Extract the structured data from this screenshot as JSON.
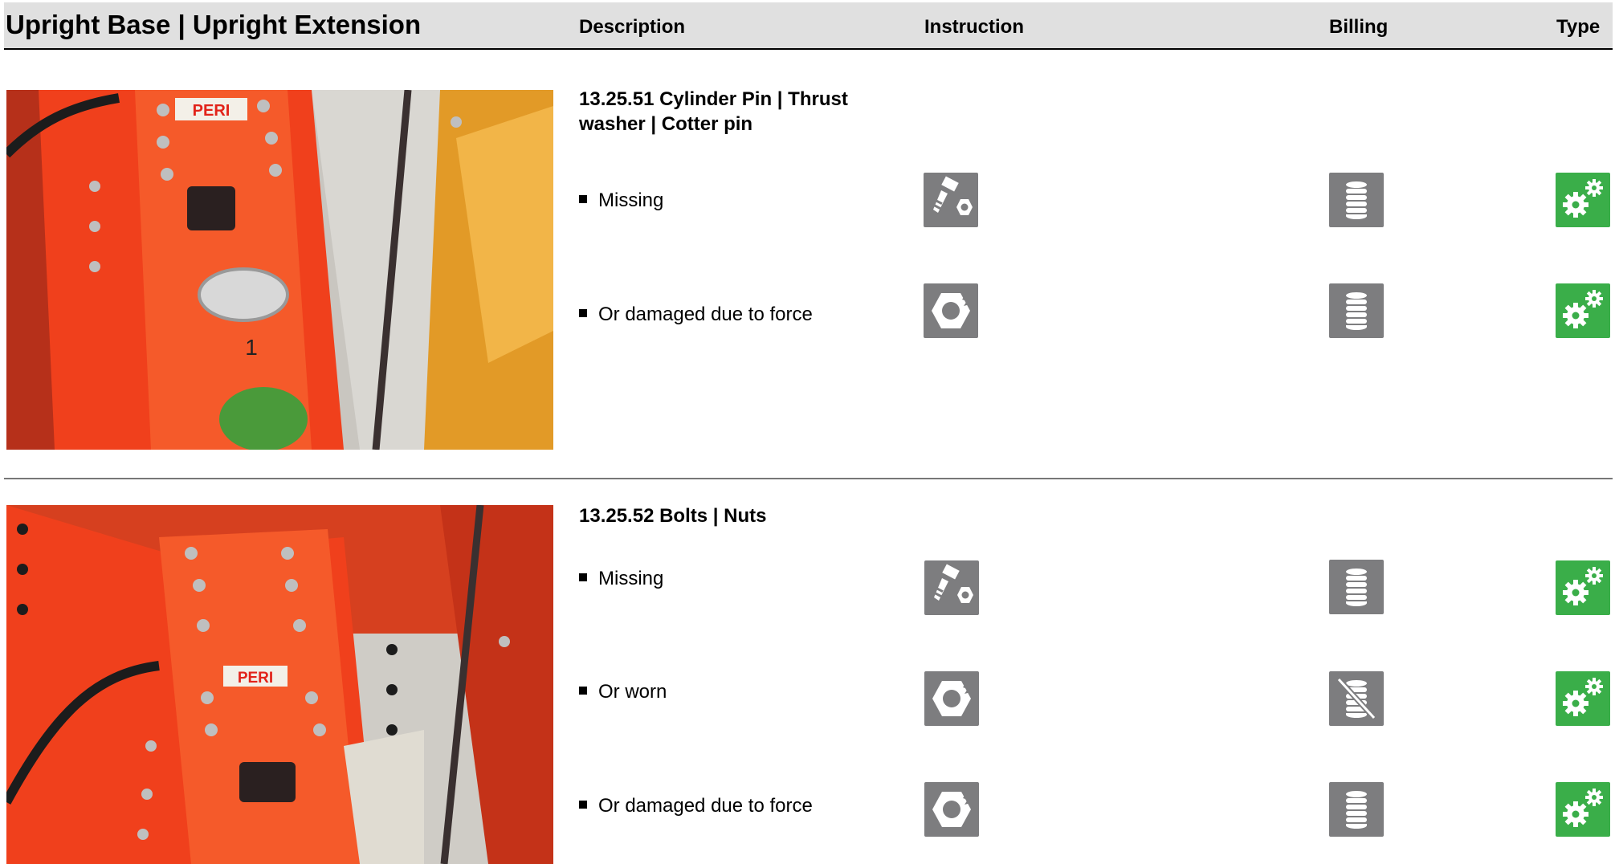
{
  "header": {
    "title": "Upright Base | Upright Extension",
    "col_description": "Description",
    "col_instruction": "Instruction",
    "col_billing": "Billing",
    "col_type": "Type"
  },
  "groups": [
    {
      "title": "13.25.51 Cylinder Pin | Thrust washer | Cotter pin",
      "photo_label": "PERI",
      "photo_number": "1",
      "items": [
        {
          "text": "Missing",
          "instruction_icon": "bolt-nut-icon",
          "billing_icon": "billing-stack-icon",
          "type_icon": "gears-icon"
        },
        {
          "text": "Or damaged due to force",
          "instruction_icon": "damaged-nut-icon",
          "billing_icon": "billing-stack-icon",
          "type_icon": "gears-icon"
        }
      ]
    },
    {
      "title": "13.25.52 Bolts | Nuts",
      "photo_label": "PERI",
      "items": [
        {
          "text": "Missing",
          "instruction_icon": "bolt-nut-icon",
          "billing_icon": "billing-stack-icon",
          "type_icon": "gears-icon"
        },
        {
          "text": "Or worn",
          "instruction_icon": "damaged-nut-icon",
          "billing_icon": "no-billing-icon",
          "type_icon": "gears-icon"
        },
        {
          "text": "Or damaged due to force",
          "instruction_icon": "damaged-nut-icon",
          "billing_icon": "billing-stack-icon",
          "type_icon": "gears-icon"
        }
      ]
    }
  ],
  "colors": {
    "icon_gray": "#7d7d7f",
    "icon_green": "#3aae49",
    "header_bg": "#e0e0e0",
    "component_red": "#f0401c",
    "formwork_orange": "#e8a22a"
  }
}
